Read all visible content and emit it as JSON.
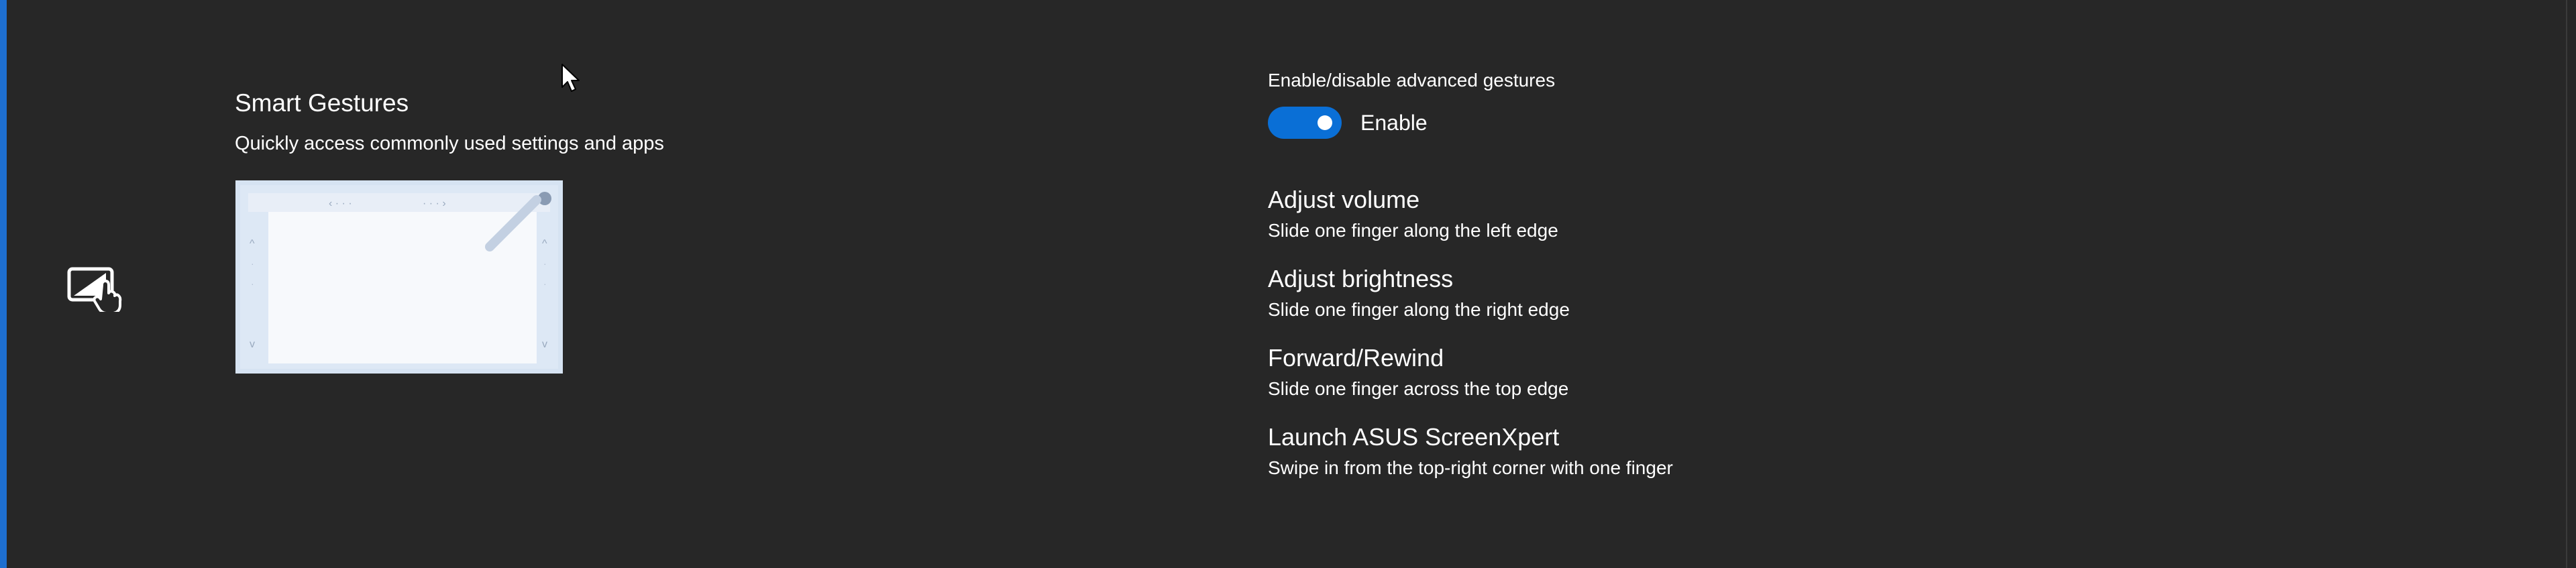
{
  "feature": {
    "title": "Smart Gestures",
    "subtitle": "Quickly access commonly used settings and apps",
    "icon": "touch-gesture-icon"
  },
  "toggle": {
    "caption": "Enable/disable advanced gestures",
    "label": "Enable",
    "state": "on",
    "color": "#0a6fd6"
  },
  "gestures": [
    {
      "title": "Adjust volume",
      "desc": "Slide one finger along the left edge"
    },
    {
      "title": "Adjust brightness",
      "desc": "Slide one finger along the right edge"
    },
    {
      "title": "Forward/Rewind",
      "desc": "Slide one finger across the top edge"
    },
    {
      "title": "Launch ASUS ScreenXpert",
      "desc": "Swipe in from the top-right corner with one finger"
    }
  ],
  "colors": {
    "background": "#272727",
    "accent": "#1e6fd0",
    "text": "#ffffff"
  }
}
